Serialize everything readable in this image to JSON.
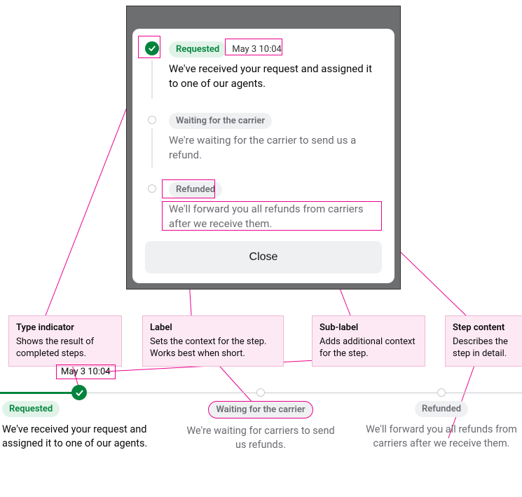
{
  "modal": {
    "steps": [
      {
        "indicator": "check",
        "label": "Requested",
        "label_style": "green",
        "sublabel": "May 3 10:04",
        "content": "We've received your request and assigned it to one of our agents.",
        "muted": false
      },
      {
        "indicator": "dot",
        "label": "Waiting for the carrier",
        "label_style": "gray",
        "sublabel": "",
        "content": "We're waiting for the carrier to send us a refund.",
        "muted": true
      },
      {
        "indicator": "dot",
        "label": "Refunded",
        "label_style": "gray",
        "sublabel": "",
        "content": "We'll forward you all refunds from carriers after we receive them.",
        "muted": true
      }
    ],
    "close": "Close"
  },
  "annotations": [
    {
      "title": "Type indicator",
      "body": "Shows the result of completed steps."
    },
    {
      "title": "Label",
      "body": "Sets the context for the step. Works best when short."
    },
    {
      "title": "Sub-label",
      "body": "Adds additional context for the step."
    },
    {
      "title": "Step content",
      "body": "Describes the step in detail."
    }
  ],
  "htimeline": {
    "sublabel": "May 3 10:04",
    "steps": [
      {
        "label": "Requested",
        "label_style": "green",
        "desc": "We've received your request and assigned it to one of our agents."
      },
      {
        "label": "Waiting for the carrier",
        "label_style": "gray",
        "desc": "We're waiting for carriers to send us refunds.",
        "muted": true
      },
      {
        "label": "Refunded",
        "label_style": "gray",
        "desc": "We'll forward you all refunds from carriers after we receive them.",
        "muted": true
      }
    ]
  }
}
